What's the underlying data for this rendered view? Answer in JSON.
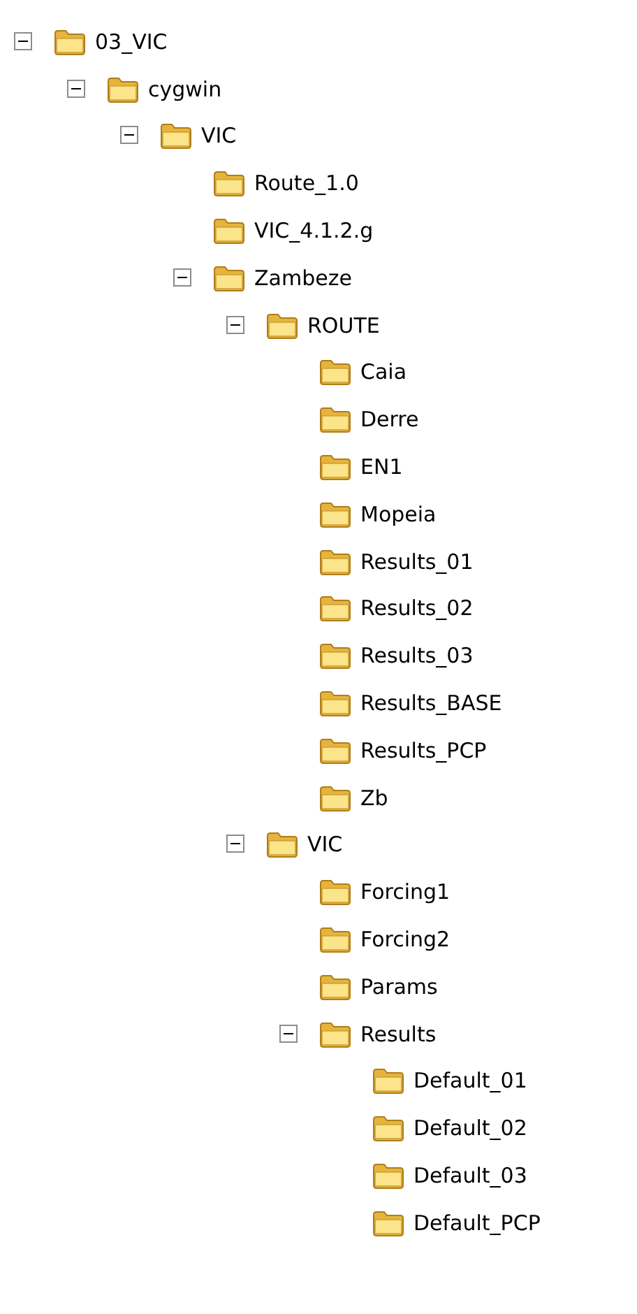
{
  "tree": [
    {
      "label": "03_VIC",
      "expanded": true,
      "children": [
        {
          "label": "cygwin",
          "expanded": true,
          "children": [
            {
              "label": "VIC",
              "expanded": true,
              "children": [
                {
                  "label": "Route_1.0",
                  "expanded": false
                },
                {
                  "label": "VIC_4.1.2.g",
                  "expanded": false
                },
                {
                  "label": "Zambeze",
                  "expanded": true,
                  "children": [
                    {
                      "label": "ROUTE",
                      "expanded": true,
                      "children": [
                        {
                          "label": "Caia",
                          "expanded": false
                        },
                        {
                          "label": "Derre",
                          "expanded": false
                        },
                        {
                          "label": "EN1",
                          "expanded": false
                        },
                        {
                          "label": "Mopeia",
                          "expanded": false
                        },
                        {
                          "label": "Results_01",
                          "expanded": false
                        },
                        {
                          "label": "Results_02",
                          "expanded": false
                        },
                        {
                          "label": "Results_03",
                          "expanded": false
                        },
                        {
                          "label": "Results_BASE",
                          "expanded": false
                        },
                        {
                          "label": "Results_PCP",
                          "expanded": false
                        },
                        {
                          "label": "Zb",
                          "expanded": false
                        }
                      ]
                    },
                    {
                      "label": "VIC",
                      "expanded": true,
                      "children": [
                        {
                          "label": "Forcing1",
                          "expanded": false
                        },
                        {
                          "label": "Forcing2",
                          "expanded": false
                        },
                        {
                          "label": "Params",
                          "expanded": false
                        },
                        {
                          "label": "Results",
                          "expanded": true,
                          "children": [
                            {
                              "label": "Default_01",
                              "expanded": false
                            },
                            {
                              "label": "Default_02",
                              "expanded": false
                            },
                            {
                              "label": "Default_03",
                              "expanded": false
                            },
                            {
                              "label": "Default_PCP",
                              "expanded": false
                            }
                          ]
                        }
                      ]
                    }
                  ]
                }
              ]
            }
          ]
        }
      ]
    }
  ]
}
